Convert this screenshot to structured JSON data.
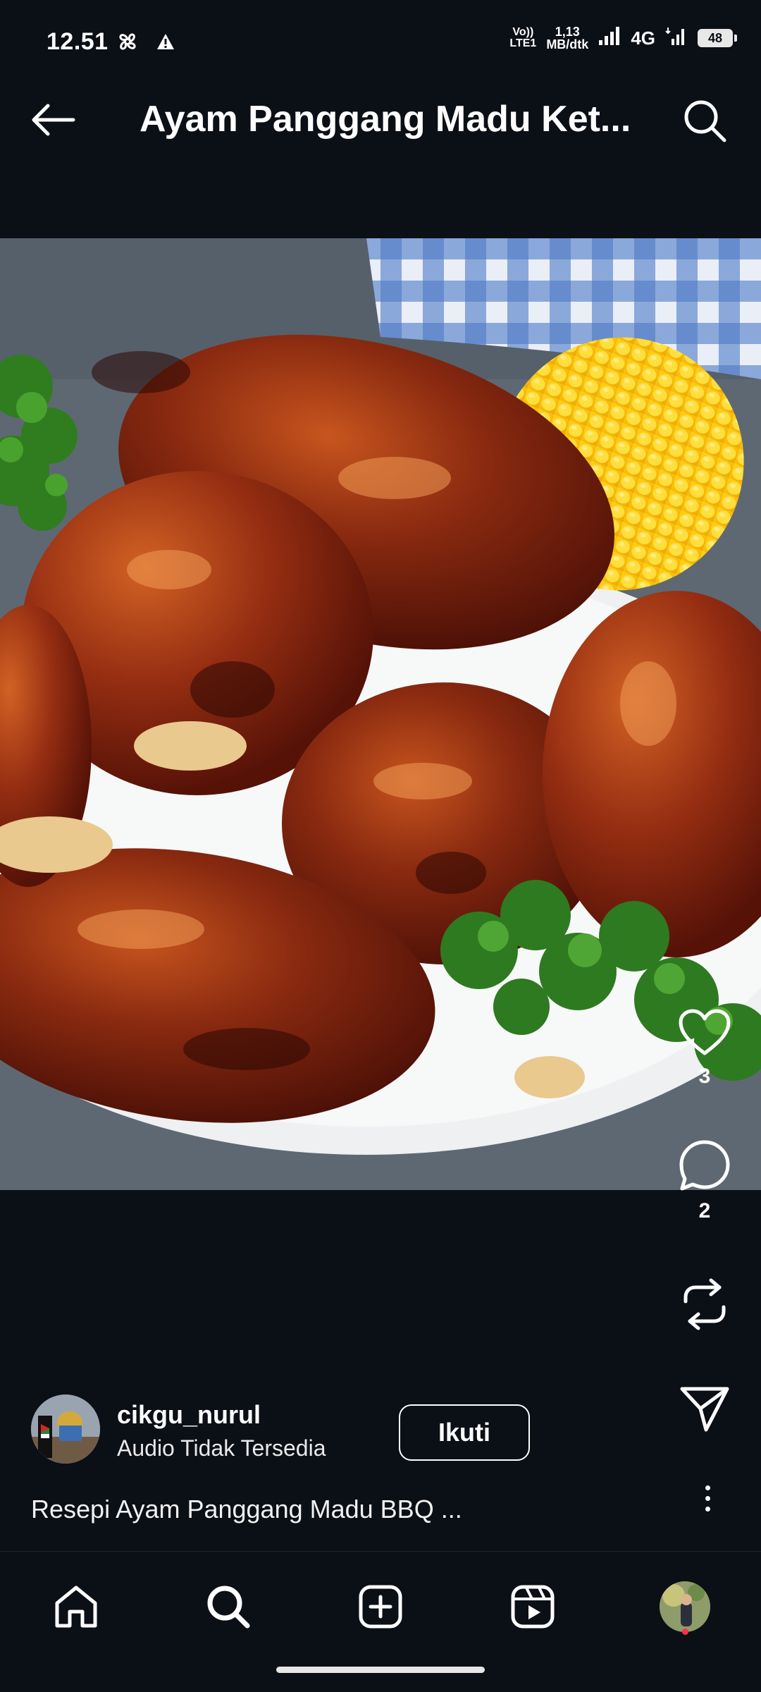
{
  "status_bar": {
    "time": "12.51",
    "volte_line1": "Vo))",
    "volte_line2": "LTE1",
    "speed_line1": "1,13",
    "speed_line2": "MB/dtk",
    "network": "4G",
    "battery": "48"
  },
  "header": {
    "title": "Ayam Panggang Madu Ket..."
  },
  "actions": {
    "likes": "3",
    "comments": "2"
  },
  "author": {
    "username": "cikgu_nurul",
    "audio": "Audio Tidak Tersedia",
    "follow_label": "Ikuti"
  },
  "caption": "Resepi Ayam Panggang Madu BBQ ...",
  "icons": {
    "back": "arrow-left-icon",
    "search": "search-icon",
    "like": "heart-icon",
    "comment": "comment-icon",
    "repost": "repost-icon",
    "share": "send-icon",
    "more": "more-vertical-icon",
    "nav_home": "home-icon",
    "nav_search": "search-icon",
    "nav_create": "plus-square-icon",
    "nav_reels": "reels-icon"
  },
  "colors": {
    "background": "#0b0f16",
    "notification_dot": "#ff2e4d"
  }
}
